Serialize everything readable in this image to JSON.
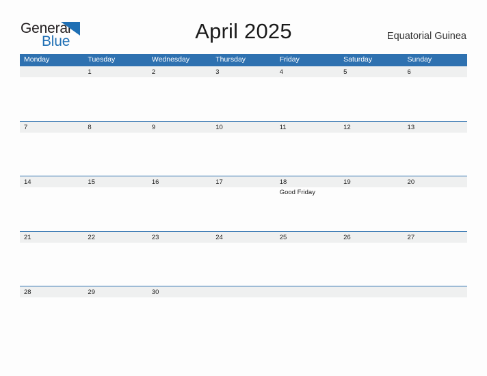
{
  "brand": {
    "name_part1": "General",
    "name_part2": "Blue",
    "flag_icon": "blue-triangle-flag-icon",
    "accent_color": "#1f6fb4"
  },
  "header": {
    "title": "April 2025",
    "country": "Equatorial Guinea"
  },
  "colors": {
    "header_blue": "#2e71b0",
    "band_gray": "#eff0f0",
    "page_background": "#fdfdfd",
    "text": "#1d1d1d"
  },
  "calendar": {
    "month": "April",
    "year": "2025",
    "weekday_headers": [
      "Monday",
      "Tuesday",
      "Wednesday",
      "Thursday",
      "Friday",
      "Saturday",
      "Sunday"
    ],
    "weeks": [
      [
        {
          "day": "",
          "event": ""
        },
        {
          "day": "1",
          "event": ""
        },
        {
          "day": "2",
          "event": ""
        },
        {
          "day": "3",
          "event": ""
        },
        {
          "day": "4",
          "event": ""
        },
        {
          "day": "5",
          "event": ""
        },
        {
          "day": "6",
          "event": ""
        }
      ],
      [
        {
          "day": "7",
          "event": ""
        },
        {
          "day": "8",
          "event": ""
        },
        {
          "day": "9",
          "event": ""
        },
        {
          "day": "10",
          "event": ""
        },
        {
          "day": "11",
          "event": ""
        },
        {
          "day": "12",
          "event": ""
        },
        {
          "day": "13",
          "event": ""
        }
      ],
      [
        {
          "day": "14",
          "event": ""
        },
        {
          "day": "15",
          "event": ""
        },
        {
          "day": "16",
          "event": ""
        },
        {
          "day": "17",
          "event": ""
        },
        {
          "day": "18",
          "event": "Good Friday"
        },
        {
          "day": "19",
          "event": ""
        },
        {
          "day": "20",
          "event": ""
        }
      ],
      [
        {
          "day": "21",
          "event": ""
        },
        {
          "day": "22",
          "event": ""
        },
        {
          "day": "23",
          "event": ""
        },
        {
          "day": "24",
          "event": ""
        },
        {
          "day": "25",
          "event": ""
        },
        {
          "day": "26",
          "event": ""
        },
        {
          "day": "27",
          "event": ""
        }
      ],
      [
        {
          "day": "28",
          "event": ""
        },
        {
          "day": "29",
          "event": ""
        },
        {
          "day": "30",
          "event": ""
        },
        {
          "day": "",
          "event": ""
        },
        {
          "day": "",
          "event": ""
        },
        {
          "day": "",
          "event": ""
        },
        {
          "day": "",
          "event": ""
        }
      ]
    ]
  }
}
